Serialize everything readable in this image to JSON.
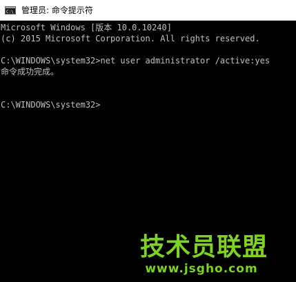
{
  "window": {
    "title": "管理员: 命令提示符",
    "icon": "cmd-icon"
  },
  "console": {
    "lines": [
      "Microsoft Windows [版本 10.0.10240]",
      "(c) 2015 Microsoft Corporation. All rights reserved.",
      "",
      "C:\\WINDOWS\\system32>net user administrator /active:yes",
      "命令成功完成。",
      "",
      "",
      "C:\\WINDOWS\\system32>"
    ]
  },
  "watermark": {
    "logo": "技术员联盟",
    "url": "www.jsgho.com"
  },
  "colors": {
    "console_bg": "#000000",
    "console_text": "#c0c0c0",
    "watermark": "#7dd321"
  }
}
